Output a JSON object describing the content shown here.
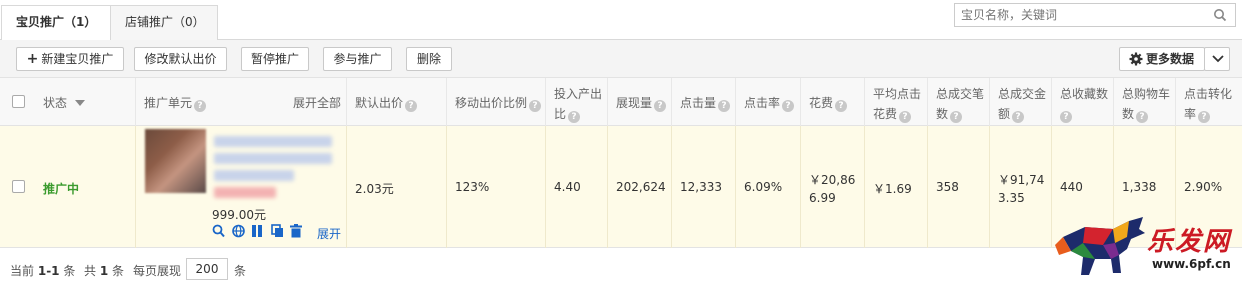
{
  "tabs": [
    {
      "label": "宝贝推广（1）",
      "active": true
    },
    {
      "label": "店铺推广（0）",
      "active": false
    }
  ],
  "search": {
    "placeholder": "宝贝名称，关键词"
  },
  "toolbar": {
    "new_label": "新建宝贝推广",
    "modify_bid_label": "修改默认出价",
    "pause_label": "暂停推广",
    "join_label": "参与推广",
    "delete_label": "删除",
    "more_data_label": "更多数据"
  },
  "table": {
    "headers": {
      "status": "状态",
      "unit": "推广单元",
      "expand_all": "展开全部",
      "default_bid": "默认出价",
      "mobile_ratio": "移动出价比例",
      "roi_1": "投入产出",
      "roi_2": "比",
      "impressions": "展现量",
      "clicks": "点击量",
      "ctr": "点击率",
      "cost": "花费",
      "avg_cpc_1": "平均点击",
      "avg_cpc_2": "花费",
      "orders_1": "总成交笔",
      "orders_2": "数",
      "gmv_1": "总成交金",
      "gmv_2": "额",
      "favorites": "总收藏数",
      "cart_1": "总购物车",
      "cart_2": "数",
      "cvr_1": "点击转化",
      "cvr_2": "率"
    },
    "row": {
      "status": "推广中",
      "price": "999.00元",
      "expand": "展开",
      "default_bid": "2.03元",
      "mobile_ratio": "123%",
      "roi": "4.40",
      "impressions": "202,624",
      "clicks": "12,333",
      "ctr": "6.09%",
      "cost_1": "￥20,86",
      "cost_2": "6.99",
      "avg_cpc": "￥1.69",
      "orders": "358",
      "gmv_1": "￥91,74",
      "gmv_2": "3.35",
      "favorites": "440",
      "cart": "1,338",
      "cvr": "2.90%"
    }
  },
  "footer": {
    "current_prefix": "当前",
    "current_range": "1-1",
    "current_suffix": "条",
    "total_prefix": "共",
    "total_count": "1",
    "total_suffix": "条",
    "per_page_label": "每页展现",
    "page_size": "200",
    "page_size_suffix": "条"
  },
  "watermark": {
    "text": "乐发网",
    "url": "www.6pf.cn"
  },
  "colors": {
    "status_green": "#3b9b2e",
    "link_blue": "#1a66c8",
    "row_highlight": "#fefbe8"
  }
}
